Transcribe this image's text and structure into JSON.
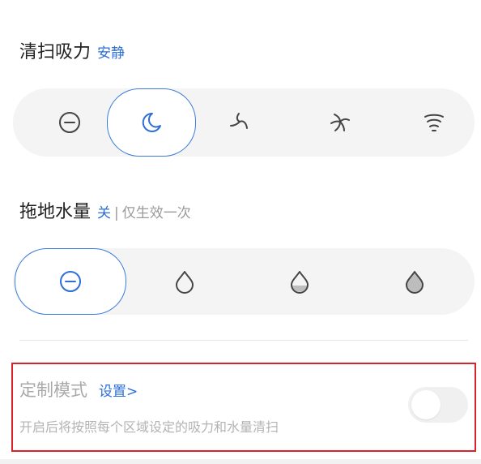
{
  "suction": {
    "title": "清扫吸力",
    "current": "安静",
    "options": [
      {
        "icon": "off-icon",
        "selected": false
      },
      {
        "icon": "quiet-moon-icon",
        "selected": true
      },
      {
        "icon": "standard-fan-icon",
        "selected": false
      },
      {
        "icon": "strong-fan-icon",
        "selected": false
      },
      {
        "icon": "max-tornado-icon",
        "selected": false
      }
    ]
  },
  "mopping": {
    "title": "拖地水量",
    "current": "关",
    "separator": "|",
    "note": "仅生效一次",
    "options": [
      {
        "icon": "off-icon",
        "selected": true,
        "level": 0
      },
      {
        "icon": "water-drop-low-icon",
        "selected": false,
        "level": 1
      },
      {
        "icon": "water-drop-medium-icon",
        "selected": false,
        "level": 2
      },
      {
        "icon": "water-drop-high-icon",
        "selected": false,
        "level": 3
      }
    ]
  },
  "custom_mode": {
    "title": "定制模式",
    "link_label": "设置>",
    "description": "开启后将按照每个区域设定的吸力和水量清扫",
    "enabled": false
  },
  "colors": {
    "accent": "#2d6fd6",
    "highlight_border": "#d6242a",
    "icon": "#444444"
  }
}
